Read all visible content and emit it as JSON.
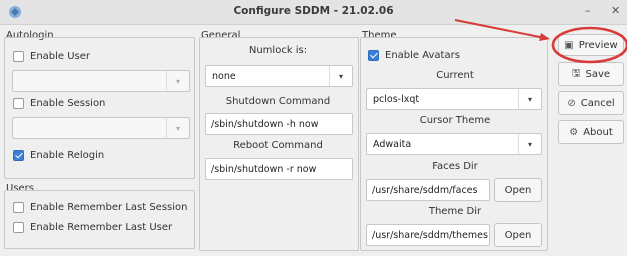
{
  "window": {
    "title": "Configure SDDM - 21.02.06"
  },
  "autologin": {
    "group_label": "Autologin",
    "enable_user": {
      "label": "Enable User",
      "checked": false
    },
    "user_select": {
      "value": ""
    },
    "enable_session": {
      "label": "Enable Session",
      "checked": false
    },
    "session_select": {
      "value": ""
    },
    "enable_relogin": {
      "label": "Enable Relogin",
      "checked": true
    }
  },
  "users": {
    "group_label": "Users",
    "remember_last_session": {
      "label": "Enable Remember Last Session",
      "checked": false
    },
    "remember_last_user": {
      "label": "Enable Remember Last User",
      "checked": false
    }
  },
  "general": {
    "group_label": "General",
    "numlock_label": "Numlock is:",
    "numlock_value": "none",
    "shutdown_label": "Shutdown Command",
    "shutdown_value": "/sbin/shutdown -h now",
    "reboot_label": "Reboot Command",
    "reboot_value": "/sbin/shutdown -r now"
  },
  "theme": {
    "group_label": "Theme",
    "enable_avatars": {
      "label": "Enable Avatars",
      "checked": true
    },
    "current_label": "Current",
    "current_value": "pclos-lxqt",
    "cursor_label": "Cursor Theme",
    "cursor_value": "Adwaita",
    "faces_label": "Faces Dir",
    "faces_value": "/usr/share/sddm/faces",
    "faces_open": "Open",
    "theme_dir_label": "Theme Dir",
    "theme_dir_value": "/usr/share/sddm/themes",
    "theme_dir_open": "Open"
  },
  "actions": {
    "preview": "Preview",
    "save": "Save",
    "cancel": "Cancel",
    "about": "About"
  },
  "colors": {
    "accent": "#3b7ed6",
    "annotation": "#d93a3a"
  },
  "icons": [
    "sddm-app-icon",
    "minimize-icon",
    "close-icon",
    "preview-icon",
    "save-icon",
    "cancel-icon",
    "about-icon"
  ]
}
